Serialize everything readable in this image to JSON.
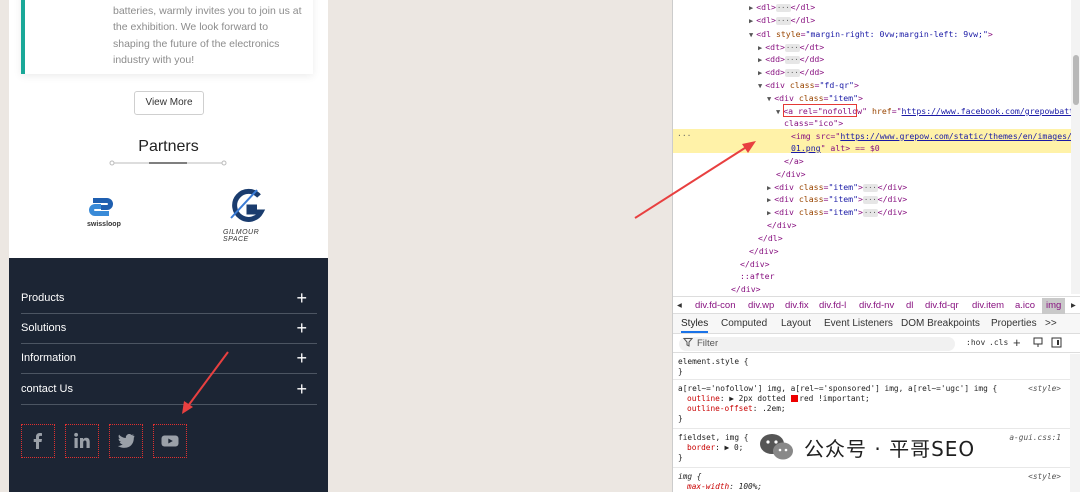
{
  "mobile": {
    "card_text_lines": [
      "batteries, warmly invites you to join us at",
      "the exhibition. We look forward to",
      "shaping the future of the electronics",
      "industry with you!"
    ],
    "view_more": "View More",
    "partners_title": "Partners",
    "partner_logos": [
      {
        "name": "swissloop",
        "text": "swissloop"
      },
      {
        "name": "gilmour-space",
        "text": "GILMOUR SPACE"
      }
    ],
    "footer_menu": [
      "Products",
      "Solutions",
      "Information",
      "contact Us"
    ],
    "social_icons": [
      "facebook-icon",
      "linkedin-icon",
      "twitter-icon",
      "youtube-icon"
    ],
    "colors": {
      "footer_bg": "#1c2534",
      "card_accent": "#1aa898",
      "highlight": "#e03030"
    }
  },
  "devtools": {
    "dom_lines": {
      "l1": "<dl>",
      "l1b": "</dl>",
      "l2": "<dl>",
      "l2b": "</dl>",
      "l3a": "<dl ",
      "l3attr": "style",
      "l3val": "\"margin-right: 0vw;margin-left: 9vw;\"",
      "l3end": ">",
      "dt": "<dt>",
      "dtc": "</dt>",
      "dd": "<dd>",
      "ddc": "</dd>",
      "divqr": "<div ",
      "class": "class",
      "fdqr": "\"fd-qr\"",
      "item": "\"item\"",
      "a_rel": "<a rel=\"nofollow\"",
      "href": "href",
      "href_url": "https://www.facebook.com/grepowbattery/",
      "a_class": "class=\"ico\">",
      "img": "<img src=",
      "img_url1": "https://www.grepow.com/static/themes/en/images/fd-ico",
      "img_url2": "01.png",
      "img_tail": "\" alt> == $0",
      "a_close": "</a>",
      "div_close": "</div>",
      "dl_close": "</dl>",
      "after": "::after"
    },
    "breadcrumb": [
      "div.fd-con",
      "div.wp",
      "div.fix",
      "div.fd-l",
      "div.fd-nv",
      "dl",
      "div.fd-qr",
      "div.item",
      "a.ico",
      "img"
    ],
    "breadcrumb_selected": "img",
    "tabs": [
      "Styles",
      "Computed",
      "Layout",
      "Event Listeners",
      "DOM Breakpoints",
      "Properties",
      ">>"
    ],
    "active_tab": "Styles",
    "filter_placeholder": "Filter",
    "hov": ":hov",
    "cls": ".cls",
    "styles": {
      "r1_sel": "element.style {",
      "close": "}",
      "r2_sel": "a[rel~='nofollow'] img, a[rel~='sponsored'] img, a[rel~='ugc'] img {",
      "r2_src": "<style>",
      "r2_p1": "outline",
      "r2_v1a": "2px dotted",
      "r2_v1b": "red !important;",
      "r2_p2": "outline-offset",
      "r2_v2": ".2em;",
      "r3_sel": "fieldset, img {",
      "r3_src": "a-gui.css:1",
      "r3_p1": "border",
      "r3_v1": "0;",
      "r4_sel": "img {",
      "r4_src": "<style>",
      "r4_p1": "max-width",
      "r4_v1": "100%;"
    }
  },
  "watermark": {
    "text": "公众号 · 平哥SEO",
    "icon": "wechat-icon"
  }
}
